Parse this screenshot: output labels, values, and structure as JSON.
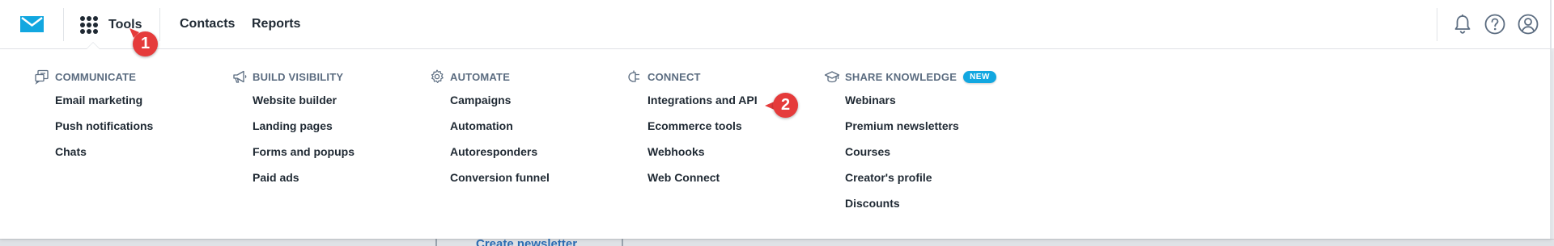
{
  "colors": {
    "brand": "#12a7e0",
    "badge": "#e53b3b",
    "text": "#1f2933",
    "muted": "#5b6c80"
  },
  "topbar": {
    "logo_icon": "envelope-logo-icon",
    "tools_icon": "grid-dots-icon",
    "tools_label": "Tools",
    "contacts_label": "Contacts",
    "reports_label": "Reports",
    "right_icons": [
      "bell-icon",
      "help-icon",
      "user-account-icon"
    ]
  },
  "step_badges": [
    "1",
    "2"
  ],
  "menu": {
    "columns": [
      {
        "icon": "communicate-icon",
        "title": "COMMUNICATE",
        "items": [
          "Email marketing",
          "Push notifications",
          "Chats"
        ]
      },
      {
        "icon": "megaphone-icon",
        "title": "BUILD VISIBILITY",
        "items": [
          "Website builder",
          "Landing pages",
          "Forms and popups",
          "Paid ads"
        ]
      },
      {
        "icon": "gear-icon",
        "title": "AUTOMATE",
        "items": [
          "Campaigns",
          "Automation",
          "Autoresponders",
          "Conversion funnel"
        ]
      },
      {
        "icon": "plug-icon",
        "title": "CONNECT",
        "items": [
          "Integrations and API",
          "Ecommerce tools",
          "Webhooks",
          "Web Connect"
        ]
      },
      {
        "icon": "graduation-cap-icon",
        "title": "SHARE KNOWLEDGE",
        "badge": "NEW",
        "items": [
          "Webinars",
          "Premium newsletters",
          "Courses",
          "Creator's profile",
          "Discounts"
        ]
      }
    ]
  },
  "background": {
    "partial_link": "Create newsletter"
  }
}
